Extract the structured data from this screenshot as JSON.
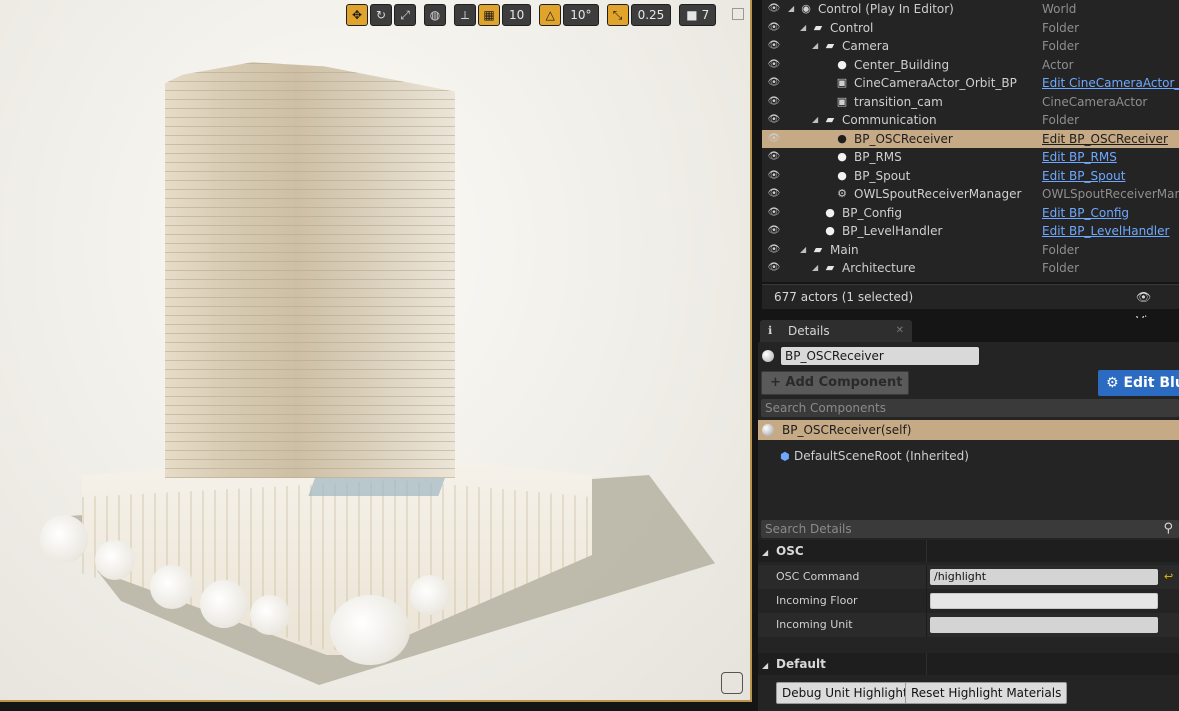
{
  "viewport": {
    "toolbar": {
      "grid_snap_value": "10",
      "rotation_snap_value": "10°",
      "scale_snap_value": "0.25",
      "camera_speed_value": "7"
    }
  },
  "outliner": {
    "rows": [
      {
        "label": "Control (Play In Editor)",
        "type": "World",
        "type_style": "grey",
        "depth": 0,
        "icon": "world-icon",
        "selected": false
      },
      {
        "label": "Control",
        "type": "Folder",
        "type_style": "grey",
        "depth": 1,
        "icon": "folder-icon",
        "selected": false
      },
      {
        "label": "Camera",
        "type": "Folder",
        "type_style": "grey",
        "depth": 2,
        "icon": "folder-icon",
        "selected": false
      },
      {
        "label": "Center_Building",
        "type": "Actor",
        "type_style": "grey",
        "depth": 3,
        "icon": "actor-sphere-icon",
        "selected": false
      },
      {
        "label": "CineCameraActor_Orbit_BP",
        "type": "Edit CineCameraActor_Or",
        "type_style": "link",
        "depth": 3,
        "icon": "camera-icon",
        "selected": false
      },
      {
        "label": "transition_cam",
        "type": "CineCameraActor",
        "type_style": "grey",
        "depth": 3,
        "icon": "camera-icon",
        "selected": false
      },
      {
        "label": "Communication",
        "type": "Folder",
        "type_style": "grey",
        "depth": 2,
        "icon": "folder-icon",
        "selected": false
      },
      {
        "label": "BP_OSCReceiver",
        "type": "Edit BP_OSCReceiver",
        "type_style": "link",
        "depth": 3,
        "icon": "actor-sphere-icon",
        "selected": true
      },
      {
        "label": "BP_RMS",
        "type": "Edit BP_RMS",
        "type_style": "link",
        "depth": 3,
        "icon": "actor-sphere-icon",
        "selected": false
      },
      {
        "label": "BP_Spout",
        "type": "Edit BP_Spout",
        "type_style": "link",
        "depth": 3,
        "icon": "actor-sphere-icon",
        "selected": false
      },
      {
        "label": "OWLSpoutReceiverManager",
        "type": "OWLSpoutReceiverManag",
        "type_style": "grey",
        "depth": 3,
        "icon": "gear-icon",
        "selected": false
      },
      {
        "label": "BP_Config",
        "type": "Edit BP_Config",
        "type_style": "link",
        "depth": 2,
        "icon": "actor-sphere-icon",
        "selected": false
      },
      {
        "label": "BP_LevelHandler",
        "type": "Edit BP_LevelHandler",
        "type_style": "link",
        "depth": 2,
        "icon": "actor-sphere-icon",
        "selected": false
      },
      {
        "label": "Main",
        "type": "Folder",
        "type_style": "grey",
        "depth": 1,
        "icon": "folder-icon",
        "selected": false
      },
      {
        "label": "Architecture",
        "type": "Folder",
        "type_style": "grey",
        "depth": 2,
        "icon": "folder-icon",
        "selected": false
      }
    ],
    "footer": {
      "count": "677 actors (1 selected)",
      "view_options": "View"
    }
  },
  "details": {
    "tab_label": "Details",
    "actor_name": "BP_OSCReceiver",
    "add_component": "+ Add Component",
    "edit_blueprint": "Edit Blu",
    "search_components_placeholder": "Search Components",
    "component_self": "BP_OSCReceiver(self)",
    "component_root": "DefaultSceneRoot (Inherited)",
    "search_details_placeholder": "Search Details",
    "osc_category": "OSC",
    "osc_command_label": "OSC Command",
    "osc_command_value": "/highlight",
    "incoming_floor_label": "Incoming Floor",
    "incoming_floor_value": "",
    "incoming_unit_label": "Incoming Unit",
    "incoming_unit_value": "",
    "default_category": "Default",
    "debug_button": "Debug Unit Highlight",
    "reset_button": "Reset Highlight Materials"
  },
  "colors": {
    "selection": "#c6a985",
    "accent": "#e0a42c",
    "link": "#6fa8ff",
    "blueprint_button": "#2b6bc2"
  }
}
